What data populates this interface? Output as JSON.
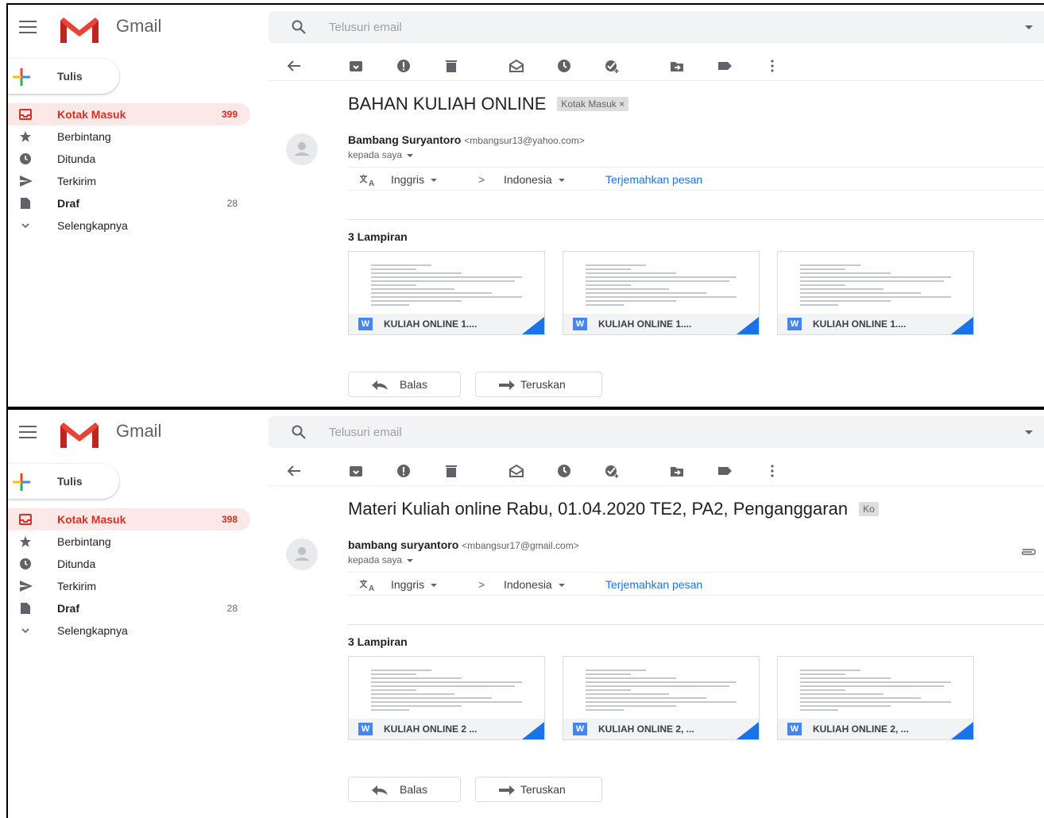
{
  "app": {
    "name": "Gmail",
    "search_placeholder": "Telusuri email"
  },
  "compose_label": "Tulis",
  "colors": {
    "accent_red": "#d93025",
    "link_blue": "#1a73e8",
    "word_blue": "#4285f4"
  },
  "panels": [
    {
      "nav": [
        {
          "label": "Kotak Masuk",
          "count": "399",
          "icon": "inbox-icon",
          "active": true
        },
        {
          "label": "Berbintang",
          "count": "",
          "icon": "star-icon"
        },
        {
          "label": "Ditunda",
          "count": "",
          "icon": "clock-icon"
        },
        {
          "label": "Terkirim",
          "count": "",
          "icon": "send-icon"
        },
        {
          "label": "Draf",
          "count": "28",
          "icon": "draft-icon",
          "bold": true
        },
        {
          "label": "Selengkapnya",
          "count": "",
          "icon": "chevron-down-icon"
        }
      ],
      "subject": "BAHAN KULIAH ONLINE",
      "label_chip": "Kotak Masuk ×",
      "sender_name": "Bambang Suryantoro",
      "sender_email": "<mbangsur13@yahoo.com>",
      "to": "kepada saya",
      "translate": {
        "from": "Inggris",
        "arrow": ">",
        "to": "Indonesia",
        "link": "Terjemahkan pesan"
      },
      "attachments_title": "3 Lampiran",
      "attachments": [
        {
          "name": "KULIAH ONLINE 1...."
        },
        {
          "name": "KULIAH ONLINE 1...."
        },
        {
          "name": "KULIAH ONLINE 1...."
        }
      ],
      "reply_label": "Balas",
      "forward_label": "Teruskan"
    },
    {
      "nav": [
        {
          "label": "Kotak Masuk",
          "count": "398",
          "icon": "inbox-icon",
          "active": true
        },
        {
          "label": "Berbintang",
          "count": "",
          "icon": "star-icon"
        },
        {
          "label": "Ditunda",
          "count": "",
          "icon": "clock-icon"
        },
        {
          "label": "Terkirim",
          "count": "",
          "icon": "send-icon"
        },
        {
          "label": "Draf",
          "count": "28",
          "icon": "draft-icon",
          "bold": true
        },
        {
          "label": "Selengkapnya",
          "count": "",
          "icon": "chevron-down-icon"
        }
      ],
      "subject": "Materi Kuliah online Rabu, 01.04.2020 TE2, PA2, Penganggaran",
      "label_chip": "Ko",
      "sender_name": "bambang suryantoro",
      "sender_email": "<mbangsur17@gmail.com>",
      "to": "kepada saya",
      "translate": {
        "from": "Inggris",
        "arrow": ">",
        "to": "Indonesia",
        "link": "Terjemahkan pesan"
      },
      "attachments_title": "3 Lampiran",
      "attachments": [
        {
          "name": "KULIAH ONLINE 2 ..."
        },
        {
          "name": "KULIAH ONLINE 2, ..."
        },
        {
          "name": "KULIAH ONLINE 2, ..."
        }
      ],
      "reply_label": "Balas",
      "forward_label": "Teruskan"
    }
  ]
}
